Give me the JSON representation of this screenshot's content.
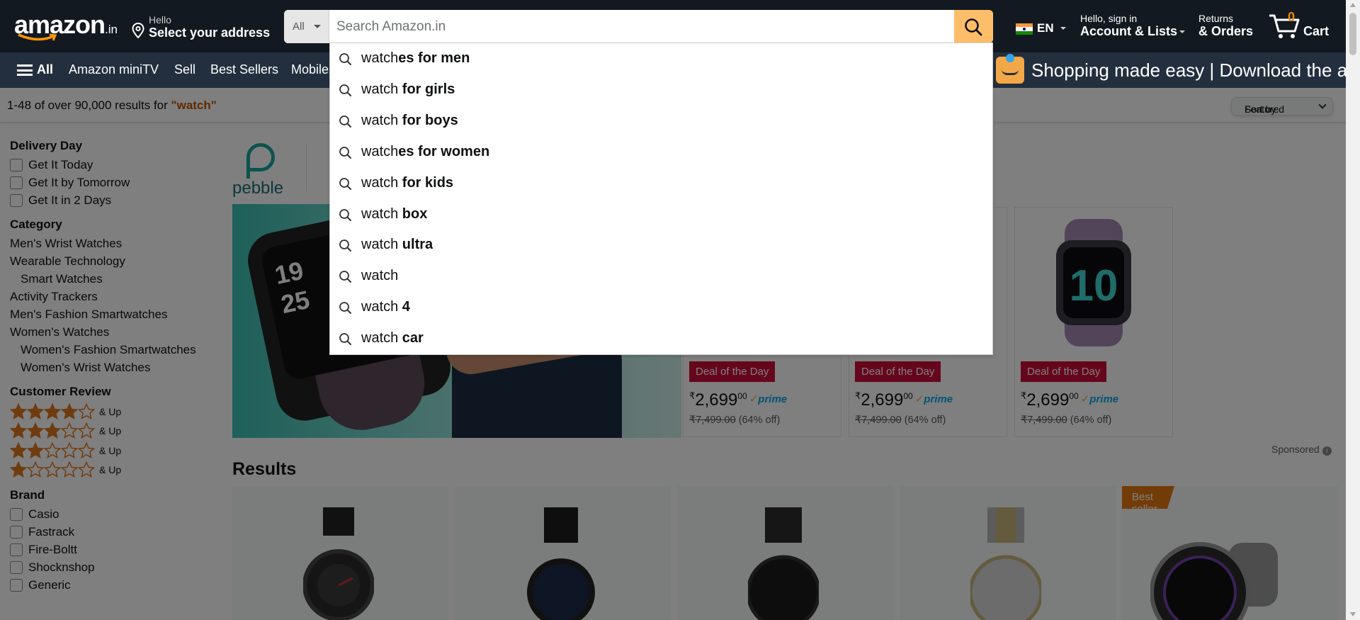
{
  "header": {
    "logo": "amazon",
    "logo_tld": ".in",
    "address_line1": "Hello",
    "address_line2": "Select your address",
    "search_category": "All",
    "search_placeholder": "Search Amazon.in",
    "language": "EN",
    "account_line1": "Hello, sign in",
    "account_line2": "Account & Lists",
    "returns_line1": "Returns",
    "returns_line2": "& Orders",
    "cart_count": "0",
    "cart_label": "Cart"
  },
  "subnav": {
    "all_label": "All",
    "items": [
      "Amazon miniTV",
      "Sell",
      "Best Sellers",
      "Mobiles"
    ],
    "promo": "Shopping made easy | Download the app"
  },
  "results_bar": {
    "prefix": "1-48 of over 90,000 results for ",
    "query": "\"watch\"",
    "sort_label": "Sort by:",
    "sort_value": "Featured"
  },
  "sidebar": {
    "delivery_title": "Delivery Day",
    "delivery": [
      "Get It Today",
      "Get It by Tomorrow",
      "Get It in 2 Days"
    ],
    "category_title": "Category",
    "categories": [
      {
        "label": "Men's Wrist Watches",
        "indent": false
      },
      {
        "label": "Wearable Technology",
        "indent": false
      },
      {
        "label": "Smart Watches",
        "indent": true
      },
      {
        "label": "Activity Trackers",
        "indent": false
      },
      {
        "label": "Men's Fashion Smartwatches",
        "indent": false
      },
      {
        "label": "Women's Watches",
        "indent": false
      },
      {
        "label": "Women's Fashion Smartwatches",
        "indent": true
      },
      {
        "label": "Women's Wrist Watches",
        "indent": true
      }
    ],
    "review_title": "Customer Review",
    "reviews": [
      {
        "stars": 4,
        "label": "& Up"
      },
      {
        "stars": 3,
        "label": "& Up"
      },
      {
        "stars": 2,
        "label": "& Up"
      },
      {
        "stars": 1,
        "label": "& Up"
      }
    ],
    "brand_title": "Brand",
    "brands": [
      "Casio",
      "Fastrack",
      "Fire-Boltt",
      "Shocknshop",
      "Generic"
    ]
  },
  "sponsored_banner": {
    "brand": "pebble",
    "hero_time": [
      "19",
      "25"
    ],
    "deals": [
      {
        "badge": "Deal of the Day",
        "currency": "₹",
        "price": "2,699",
        "paise": "00",
        "prime": "prime",
        "mrp": "₹7,499.00",
        "discount": "(64% off)"
      },
      {
        "badge": "Deal of the Day",
        "currency": "₹",
        "price": "2,699",
        "paise": "00",
        "prime": "prime",
        "mrp": "₹7,499.00",
        "discount": "(64% off)"
      },
      {
        "badge": "Deal of the Day",
        "currency": "₹",
        "price": "2,699",
        "paise": "00",
        "prime": "prime",
        "mrp": "₹7,499.00",
        "discount": "(64% off)"
      }
    ],
    "sponsored_label": "Sponsored"
  },
  "results": {
    "title": "Results",
    "best_seller": "Best seller"
  },
  "suggestions": [
    {
      "typed": "watch",
      "rest": "es for men"
    },
    {
      "typed": "watch",
      "rest": " for girls"
    },
    {
      "typed": "watch",
      "rest": " for boys"
    },
    {
      "typed": "watch",
      "rest": "es for women"
    },
    {
      "typed": "watch",
      "rest": " for kids"
    },
    {
      "typed": "watch",
      "rest": " box"
    },
    {
      "typed": "watch",
      "rest": " ultra"
    },
    {
      "typed": "watch",
      "rest": ""
    },
    {
      "typed": "watch",
      "rest": " 4"
    },
    {
      "typed": "watch",
      "rest": " car"
    }
  ],
  "colors": {
    "nav_dark": "#131921",
    "nav_sub": "#232f3e",
    "search_button": "#febd69",
    "deal_badge": "#cc0c39",
    "query_text": "#c45500",
    "best_seller": "#e47911",
    "star": "#de7921"
  },
  "icons": [
    "location-pin-icon",
    "search-icon",
    "india-flag-icon",
    "cart-icon",
    "hamburger-icon",
    "star-icon",
    "info-icon"
  ]
}
